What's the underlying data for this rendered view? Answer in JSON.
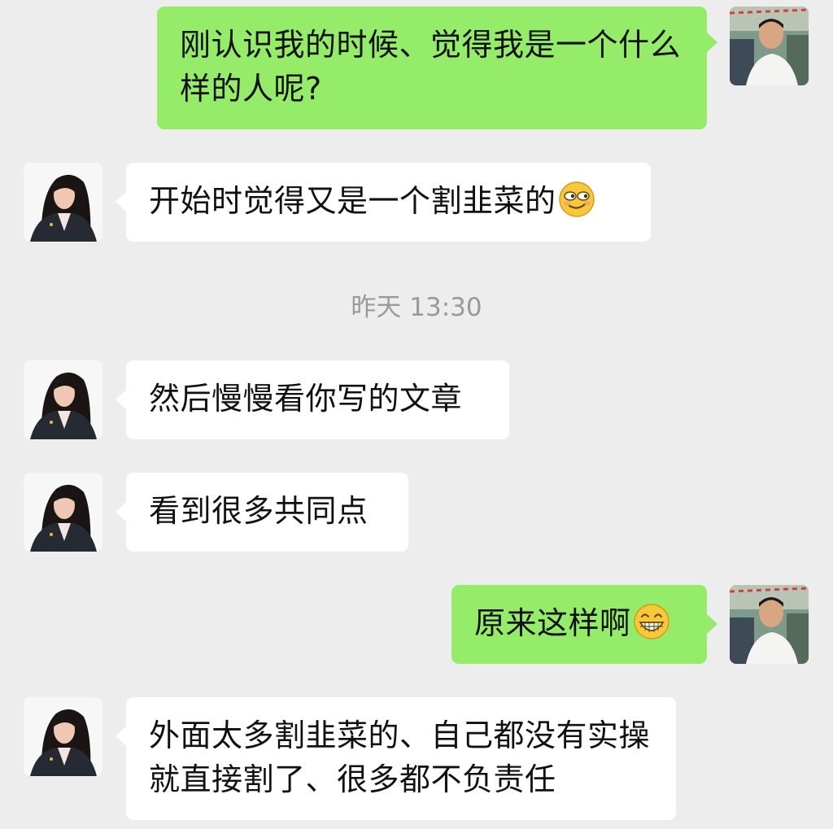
{
  "chat": {
    "timestamp": "昨天 13:30",
    "messages": [
      {
        "sender": "me",
        "text": "刚认识我的时候、觉得我是一个什么样的人呢?"
      },
      {
        "sender": "other",
        "text": "开始时觉得又是一个割韭菜的",
        "emoji": "smirk-emoji"
      },
      {
        "sender": "other",
        "text": "然后慢慢看你写的文章"
      },
      {
        "sender": "other",
        "text": "看到很多共同点"
      },
      {
        "sender": "me",
        "text": "原来这样啊",
        "emoji": "grin-emoji"
      },
      {
        "sender": "other",
        "text": "外面太多割韭菜的、自己都没有实操就直接割了、很多都不负责任"
      }
    ]
  },
  "colors": {
    "background": "#ededed",
    "bubble_in": "#ffffff",
    "bubble_out": "#95ec69",
    "timestamp_text": "#9a9a9a"
  }
}
